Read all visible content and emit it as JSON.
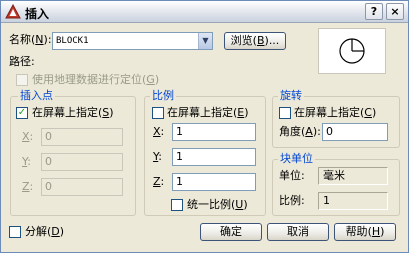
{
  "title": "插入",
  "title_help": "?",
  "title_close": "×",
  "name": {
    "label": "名称",
    "key": "N",
    "value": "BLOCK1"
  },
  "browse": {
    "label": "浏览",
    "key": "B",
    "suffix": "..."
  },
  "path_label": "路径:",
  "geo": {
    "label": "使用地理数据进行定位",
    "key": "G"
  },
  "insertion": {
    "title": "插入点",
    "on_screen": {
      "label": "在屏幕上指定",
      "key": "S"
    },
    "x": {
      "label": "X",
      "value": "0"
    },
    "y": {
      "label": "Y",
      "value": "0"
    },
    "z": {
      "label": "Z",
      "value": "0"
    }
  },
  "scale": {
    "title": "比例",
    "on_screen": {
      "label": "在屏幕上指定",
      "key": "E"
    },
    "x": {
      "label": "X",
      "value": "1"
    },
    "y": {
      "label": "Y",
      "value": "1"
    },
    "z": {
      "label": "Z",
      "value": "1"
    },
    "uniform": {
      "label": "统一比例",
      "key": "U"
    }
  },
  "rotation": {
    "title": "旋转",
    "on_screen": {
      "label": "在屏幕上指定",
      "key": "C"
    },
    "angle": {
      "label": "角度",
      "key": "A",
      "value": "0"
    }
  },
  "block_unit": {
    "title": "块单位",
    "unit": {
      "label": "单位:",
      "value": "毫米"
    },
    "factor": {
      "label": "比例:",
      "value": "1"
    }
  },
  "explode": {
    "label": "分解",
    "key": "D"
  },
  "buttons": {
    "ok": "确定",
    "cancel": "取消",
    "help": "帮助",
    "help_key": "H"
  },
  "colors": {
    "accent": "#0046d5",
    "checkmark": "#21a121"
  }
}
